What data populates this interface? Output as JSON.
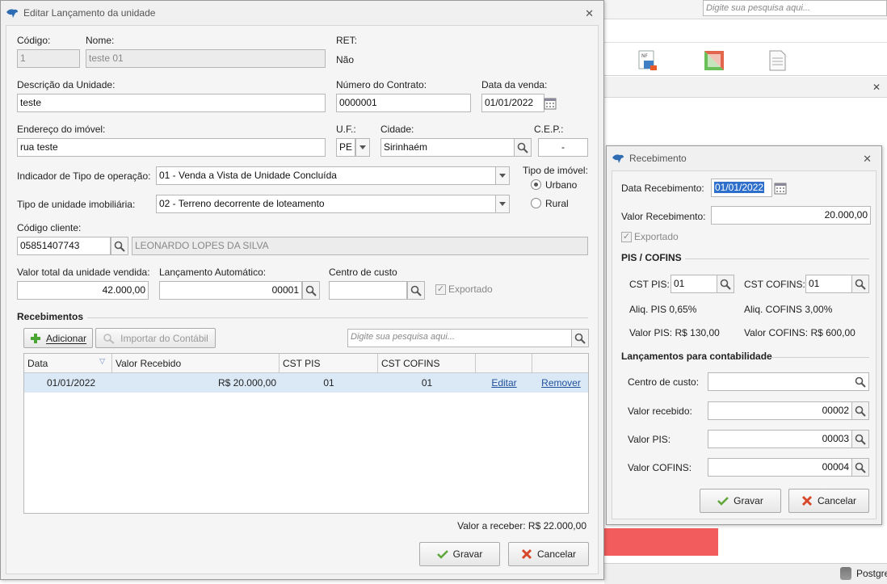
{
  "background": {
    "search_placeholder": "Digite sua pesquisa aqui...",
    "status_text": "Postgre"
  },
  "main_window": {
    "title": "Editar Lançamento da unidade",
    "codigo": {
      "label": "Código:",
      "value": "1"
    },
    "nome": {
      "label": "Nome:",
      "value": "teste 01"
    },
    "ret": {
      "label": "RET:",
      "value": "Não"
    },
    "descricao": {
      "label": "Descrição da Unidade:",
      "value": "teste"
    },
    "contrato": {
      "label": "Número do Contrato:",
      "value": "0000001"
    },
    "data_venda": {
      "label": "Data da venda:",
      "value": "01/01/2022"
    },
    "endereco": {
      "label": "Endereço do imóvel:",
      "value": "rua teste"
    },
    "uf": {
      "label": "U.F.:",
      "value": "PE"
    },
    "cidade": {
      "label": "Cidade:",
      "value": "Sirinhaém"
    },
    "cep": {
      "label": "C.E.P.:",
      "value": "-"
    },
    "indicador": {
      "label": "Indicador de Tipo de operação:",
      "value": "01 - Venda a Vista de Unidade Concluída"
    },
    "tipo_unidade": {
      "label": "Tipo de unidade imobiliária:",
      "value": "02 - Terreno decorrente de loteamento"
    },
    "tipo_imovel": {
      "label": "Tipo de imóvel:",
      "option_urbano": "Urbano",
      "option_rural": "Rural",
      "selected": "Urbano"
    },
    "codigo_cliente": {
      "label": "Código cliente:",
      "value": "05851407743",
      "name": "LEONARDO LOPES DA SILVA"
    },
    "valor_total": {
      "label": "Valor total da unidade vendida:",
      "value": "42.000,00"
    },
    "lanc_auto": {
      "label": "Lançamento Automático:",
      "value": "00001"
    },
    "centro_custo": {
      "label": "Centro de custo",
      "value": ""
    },
    "exportado_label": "Exportado",
    "recebimentos": {
      "title": "Recebimentos",
      "add_button": "Adicionar",
      "import_button": "Importar do Contábil",
      "search_placeholder": "Digite sua pesquisa aqui...",
      "columns": [
        "Data",
        "Valor Recebido",
        "CST PIS",
        "CST COFINS"
      ],
      "rows": [
        {
          "data": "01/01/2022",
          "valor": "R$ 20.000,00",
          "cst_pis": "01",
          "cst_cofins": "01",
          "edit": "Editar",
          "remove": "Remover"
        }
      ]
    },
    "valor_receber": "Valor a receber: R$ 22.000,00",
    "save_button": "Gravar",
    "cancel_button": "Cancelar"
  },
  "receipt_window": {
    "title": "Recebimento",
    "data_recebimento": {
      "label": "Data Recebimento:",
      "value": "01/01/2022"
    },
    "valor_recebimento": {
      "label": "Valor Recebimento:",
      "value": "20.000,00"
    },
    "exportado_label": "Exportado",
    "pis_cofins_title": "PIS / COFINS",
    "cst_pis": {
      "label": "CST PIS:",
      "value": "01"
    },
    "cst_cofins": {
      "label": "CST COFINS:",
      "value": "01"
    },
    "aliq_pis": "Aliq. PIS 0,65%",
    "aliq_cofins": "Aliq. COFINS 3,00%",
    "valor_pis_text": "Valor PIS: R$ 130,00",
    "valor_cofins_text": "Valor COFINS: R$ 600,00",
    "contab_title": "Lançamentos para contabilidade",
    "centro_custo": {
      "label": "Centro de custo:",
      "value": ""
    },
    "valor_recebido": {
      "label": "Valor recebido:",
      "value": "00002"
    },
    "valor_pis": {
      "label": "Valor PIS:",
      "value": "00003"
    },
    "valor_cofins": {
      "label": "Valor COFINS:",
      "value": "00004"
    },
    "save_button": "Gravar",
    "cancel_button": "Cancelar"
  }
}
